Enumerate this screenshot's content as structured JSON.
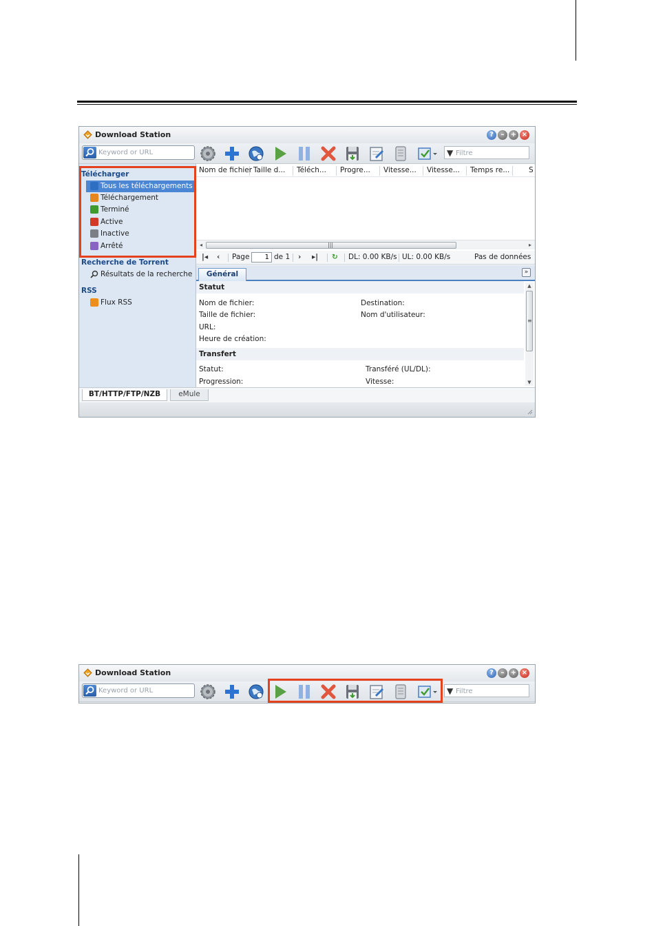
{
  "app": {
    "title": "Download Station",
    "window_controls": [
      "help-icon",
      "minimize-icon",
      "maximize-icon",
      "close-icon"
    ]
  },
  "search": {
    "placeholder": "Keyword or URL"
  },
  "filter": {
    "placeholder": "Filtre"
  },
  "toolbar_icons": [
    "settings-gear-icon",
    "add-plus-icon",
    "globe-url-icon",
    "play-resume-icon",
    "pause-icon",
    "delete-x-icon",
    "save-disk-icon",
    "edit-note-icon",
    "database-icon",
    "select-checkbox-icon"
  ],
  "sidebar": {
    "download_title": "Télécharger",
    "download_items": [
      {
        "label": "Tous les téléchargements",
        "icon": "list-icon",
        "color": "#2f6fc3",
        "selected": true
      },
      {
        "label": "Téléchargement",
        "icon": "download-arrow-icon",
        "color": "#e8861c"
      },
      {
        "label": "Terminé",
        "icon": "check-icon",
        "color": "#3f9b2e"
      },
      {
        "label": "Active",
        "icon": "active-gear-icon",
        "color": "#d23a26"
      },
      {
        "label": "Inactive",
        "icon": "inactive-square-icon",
        "color": "#7a7f86"
      },
      {
        "label": "Arrêté",
        "icon": "pause-stopped-icon",
        "color": "#8a64c4"
      }
    ],
    "torrent_title": "Recherche de Torrent",
    "torrent_items": [
      {
        "label": "Résultats de la recherche",
        "icon": "magnifier-icon"
      }
    ],
    "rss_title": "RSS",
    "rss_items": [
      {
        "label": "Flux RSS",
        "icon": "rss-feed-icon",
        "color": "#ef8c1b"
      }
    ]
  },
  "grid": {
    "columns": [
      "Nom de fichier",
      "Taille d...",
      "Téléch...",
      "Progre...",
      "Vitesse...",
      "Vitesse...",
      "Temps re...",
      "S"
    ]
  },
  "pager": {
    "page_label": "Page",
    "page_value": "1",
    "of_label": "de 1",
    "dl": "DL: 0.00 KB/s",
    "ul": "UL: 0.00 KB/s",
    "empty": "Pas de données"
  },
  "details": {
    "tab": "Général",
    "statut_title": "Statut",
    "file_name": "Nom de fichier:",
    "destination": "Destination:",
    "file_size": "Taille de fichier:",
    "user_name": "Nom d'utilisateur:",
    "url": "URL:",
    "created": "Heure de création:",
    "transfer_title": "Transfert",
    "status": "Statut:",
    "transferred": "Transféré (UL/DL):",
    "progress": "Progression:",
    "speed": "Vitesse:"
  },
  "bottom_tabs": [
    "BT/HTTP/FTP/NZB",
    "eMule"
  ],
  "colors": {
    "highlight_box": "#e5411c",
    "selection": "#4a86d4",
    "sidebar_bg": "#dce7f3"
  }
}
